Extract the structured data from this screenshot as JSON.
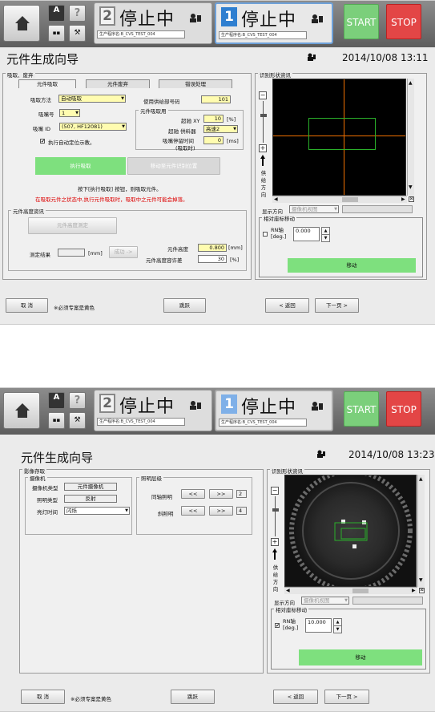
{
  "common": {
    "logo_icon": "A-badge-icon",
    "help_label": "?",
    "panel1": {
      "num": "2",
      "state": "停止中",
      "program": "生产程序名:B_CVS_TEST_004"
    },
    "panel2": {
      "num": "1",
      "state": "停止中",
      "program": "生产程序名:B_CVS_TEST_004"
    },
    "start_label": "START",
    "stop_label": "STOP",
    "title": "元件生成向导",
    "colors": {
      "start": "#7bcf7b",
      "stop": "#e34646",
      "active_panel": "#2f7fd0",
      "required": "#fffcb0",
      "green_button": "#7ee07e"
    }
  },
  "s1": {
    "datetime": "2014/10/08 13:11",
    "section_label": "吸取、废弃",
    "tabs": [
      "元件吸取",
      "元件废弃",
      "错误处理"
    ],
    "pickup_method_label": "吸取方法",
    "pickup_method_value": "自动吸取",
    "feeder_no_label": "使用供给部号码",
    "feeder_no_value": "101",
    "nozzle_no_label": "吸嘴号",
    "nozzle_no_value": "1",
    "nozzle_id_label": "吸嘴 ID",
    "nozzle_id_value": "(507, HF12081)",
    "auto_position_label": "执行自动定位示教。",
    "auto_position_checked": "✔",
    "pickup_group_label": "元件吸取用",
    "overdrive_xy_label": "超驰 XY",
    "overdrive_xy_value": "10",
    "overdrive_xy_unit": "[%]",
    "overdrive_feeder_label": "超驰 供料器",
    "overdrive_feeder_value": "高速2",
    "nozzle_wait_label": "吸嘴停留时间",
    "nozzle_wait_label2": "(吸取时)",
    "nozzle_wait_value": "0",
    "nozzle_wait_unit": "[ms]",
    "exec_pickup_button": "执行吸取",
    "move_to_camera_button": "移动至元件识别位置",
    "instruction": "按下[执行吸取] 按钮，则吸取元件。",
    "warning": "在吸取元件之状态中,执行元件吸取时，吸取中之元件可能会掉落。",
    "height_group_label": "元件高度资讯",
    "height_measure_button": "元件高度测定",
    "measure_result_label": "测定结果",
    "measure_result_unit": "[mm]",
    "success_button": "成功 ->",
    "part_height_label": "元件高度",
    "part_height_value": "0.800",
    "part_height_unit": "[mm]",
    "height_tol_label": "元件高度容许差",
    "height_tol_value": "30",
    "height_tol_unit": "[%]",
    "shape_info_label": "识别形状资讯",
    "feed_dir_label": [
      "供",
      "给",
      "方",
      "向"
    ],
    "display_dir_label": "显示方向",
    "display_dir_value": "摄像机视图",
    "rel_move_label": "相对座标移动",
    "rn_axis_label": "RN轴",
    "rn_axis_unit": "[deg.]",
    "rn_value": "0.000",
    "rn_checked": "",
    "move_button": "移动",
    "cancel_button": "取 消",
    "required_note": "※必须专案是黄色",
    "skip_button": "跳跃",
    "back_button": "< 返回",
    "next_button": "下一页 >"
  },
  "s2": {
    "datetime": "2014/10/08 13:23",
    "section_label": "影像存取",
    "camera_group_label": "摄像机",
    "camera_type_label": "摄像机类型",
    "camera_type_value": "元件摄像机",
    "light_type_label": "照明类型",
    "light_type_value": "反射",
    "light_time_label": "亮灯时间",
    "light_time_value": "闪烁",
    "light_level_group": "照明层级",
    "coax_label": "同轴照明",
    "coax_value": "2",
    "oblique_label": "斜照明",
    "oblique_value": "4",
    "dec_label": "<<",
    "inc_label": ">>",
    "shape_info_label": "识别形状资讯",
    "feed_dir_label": [
      "供",
      "给",
      "方",
      "向"
    ],
    "display_dir_label": "显示方向",
    "display_dir_value": "摄像机视图",
    "rel_move_label": "相对座标移动",
    "rn_axis_label": "RN轴",
    "rn_axis_unit": "[deg.]",
    "rn_value": "10.000",
    "rn_checked": "✔",
    "move_button": "移动",
    "cancel_button": "取 消",
    "required_note": "※必须专案是黄色",
    "skip_button": "跳跃",
    "back_button": "< 返回",
    "next_button": "下一页 >"
  }
}
